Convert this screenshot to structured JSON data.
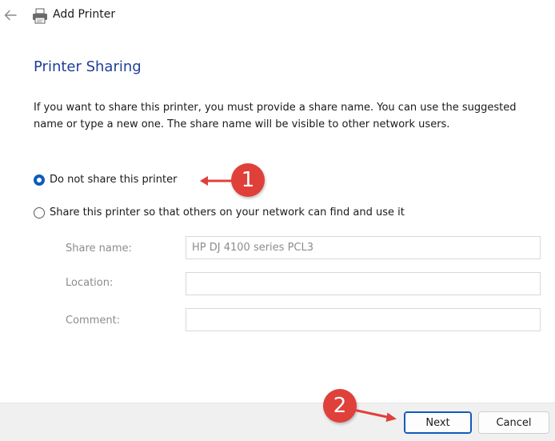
{
  "window": {
    "title": "Add Printer"
  },
  "page": {
    "title": "Printer Sharing",
    "description": "If you want to share this printer, you must provide a share name. You can use the suggested name or type a new one. The share name will be visible to other network users."
  },
  "sharing_options": [
    {
      "label": "Do not share this printer",
      "selected": true
    },
    {
      "label": "Share this printer so that others on your network can find and use it",
      "selected": false
    }
  ],
  "fields": {
    "share_name": {
      "label": "Share name:",
      "value": "HP DJ 4100 series PCL3"
    },
    "location": {
      "label": "Location:",
      "value": ""
    },
    "comment": {
      "label": "Comment:",
      "value": ""
    }
  },
  "footer": {
    "next_label": "Next",
    "cancel_label": "Cancel"
  },
  "annotations": {
    "step1": "1",
    "step2": "2"
  },
  "colors": {
    "accent": "#0e5bbd",
    "title_blue": "#1e3f99",
    "annotation_red": "#e0403a"
  },
  "icons": {
    "back": "back-arrow-icon",
    "app": "printer-icon"
  }
}
